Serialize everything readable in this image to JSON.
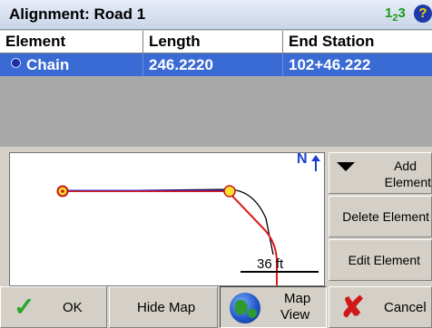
{
  "titlebar": {
    "title": "Alignment: Road 1",
    "calc_icon_label": "1",
    "calc_icon_sub": "2",
    "calc_icon_tail": "3"
  },
  "grid": {
    "columns": [
      "Element",
      "Length",
      "End Station"
    ],
    "rows": [
      {
        "element": "Chain",
        "length": "246.2220",
        "end_station": "102+46.222"
      }
    ]
  },
  "map": {
    "north_label": "N",
    "scale_label": "36 ft"
  },
  "side_buttons": {
    "add_element_line1": "Add",
    "add_element_line2": "Element",
    "delete_element": "Delete Element",
    "edit_element": "Edit Element"
  },
  "bottom_buttons": {
    "ok": "OK",
    "hide_map": "Hide Map",
    "map_view_line1": "Map",
    "map_view_line2": "View",
    "cancel": "Cancel"
  },
  "colors": {
    "selection": "#3a6ad4",
    "alignment_line": "#e01818",
    "accent_blue": "#1f2fa0"
  }
}
